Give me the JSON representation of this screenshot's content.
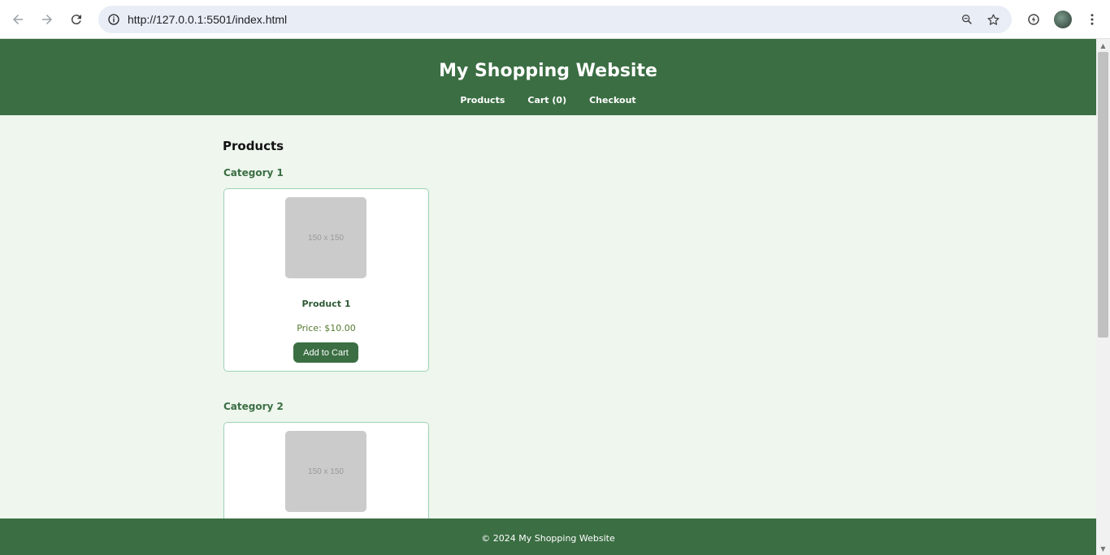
{
  "browser": {
    "url": "http://127.0.0.1:5501/index.html",
    "icons": [
      "back-icon",
      "forward-icon",
      "reload-icon",
      "info-icon",
      "zoom-icon",
      "star-icon",
      "extension-icon",
      "avatar",
      "menu-icon"
    ]
  },
  "site": {
    "title": "My Shopping Website",
    "nav": {
      "products": "Products",
      "cart": "Cart (0)",
      "checkout": "Checkout"
    },
    "footer": "© 2024 My Shopping Website"
  },
  "main": {
    "heading": "Products",
    "categories": [
      {
        "title": "Category 1",
        "product": {
          "image_text": "150 x 150",
          "name": "Product 1",
          "price": "Price: $10.00",
          "button": "Add to Cart"
        }
      },
      {
        "title": "Category 2",
        "product": {
          "image_text": "150 x 150"
        }
      }
    ]
  },
  "colors": {
    "header_bg": "#3b6e43",
    "page_bg": "#eef6ee",
    "card_border": "#9fd3b3",
    "placeholder": "#cbcbcb"
  }
}
